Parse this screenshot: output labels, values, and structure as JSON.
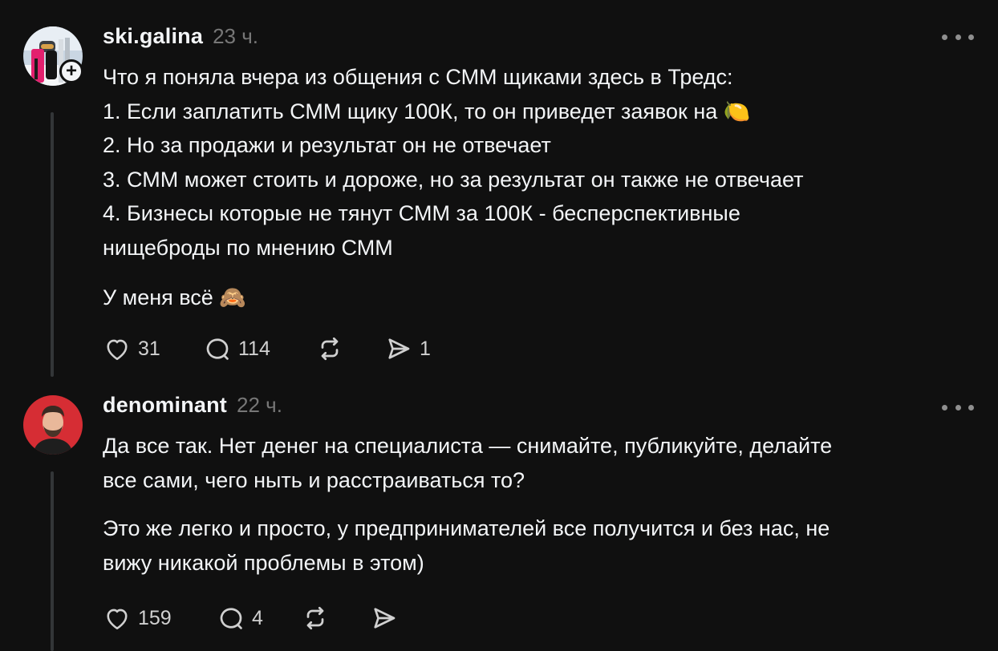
{
  "posts": [
    {
      "username": "ski.galina",
      "time": "23 ч.",
      "paragraphs": [
        "Что я поняла вчера из общения с СММ щиками здесь в Тредс:\n1. Если заплатить СММ щику 100К, то он приведет заявок на 🍋\n2. Но за продажи и результат он не отвечает\n3. СММ может стоить и дороже, но за результат он также не отвечает\n4. Бизнесы которые не тянут СММ за 100К - бесперспективные\nнищеброды по мнению СММ",
        "У меня всё 🙈"
      ],
      "likes": "31",
      "replies": "114",
      "shares": "1",
      "avatar_icon": "skier-avatar-photo",
      "follow_icon": "plus-icon"
    },
    {
      "username": "denominant",
      "time": "22 ч.",
      "paragraphs": [
        "Да все так. Нет денег на специалиста — снимайте, публикуйте, делайте\nвсе сами, чего ныть и расстраиваться то?",
        "Это же легко и просто, у предпринимателей все получится и без нас, не\nвижу никакой проблемы в этом)"
      ],
      "likes": "159",
      "replies": "4",
      "shares": "",
      "avatar_icon": "man-portrait-avatar-photo"
    }
  ],
  "colors": {
    "background": "#101010",
    "text": "#f3f5f7",
    "secondary": "#777777",
    "thread_line": "#333638"
  }
}
